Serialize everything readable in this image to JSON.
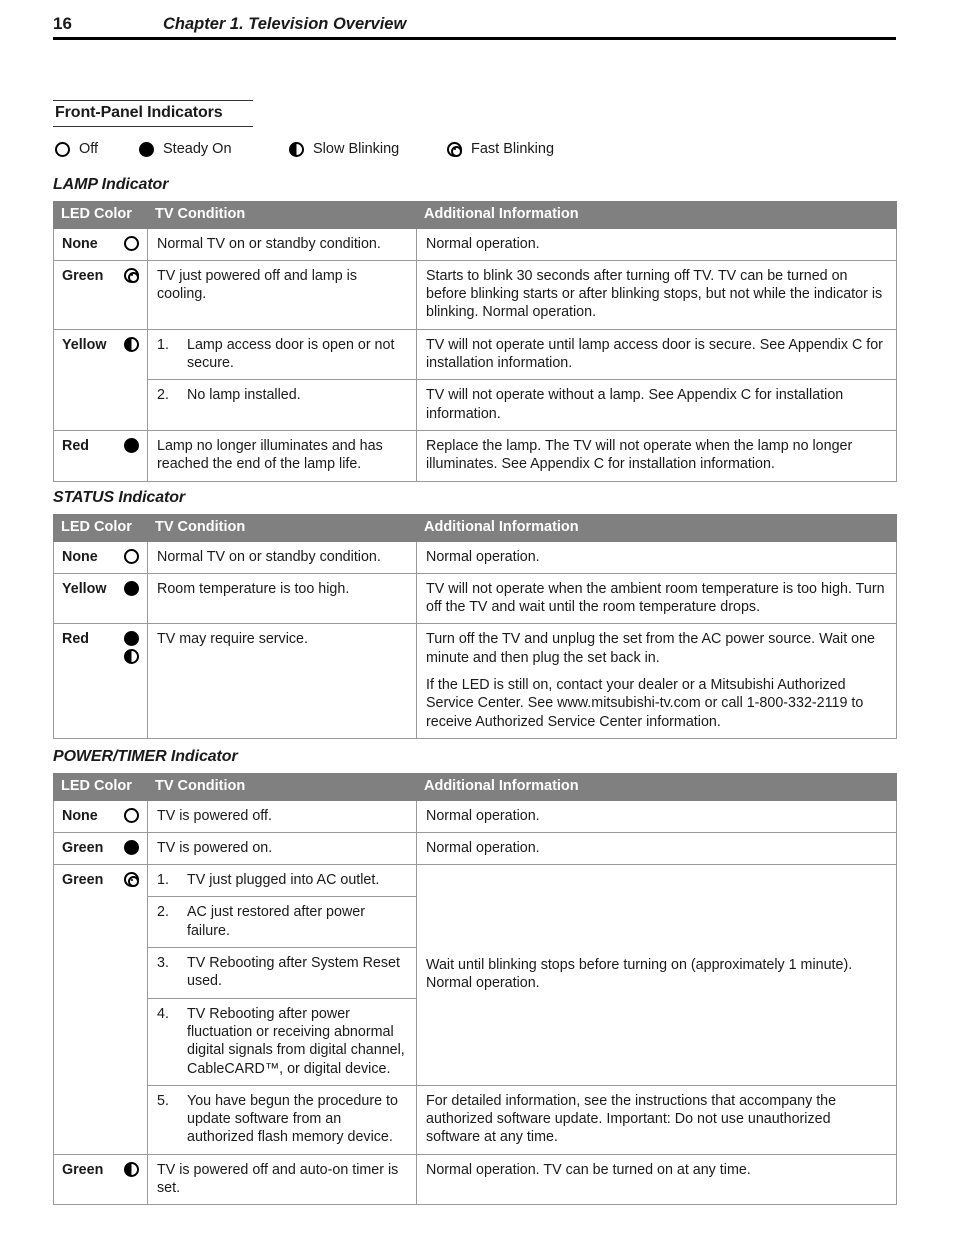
{
  "header": {
    "page_number": "16",
    "chapter_title": "Chapter 1. Television Overview"
  },
  "section": {
    "title": "Front-Panel Indicators"
  },
  "legend": {
    "items": [
      {
        "icon": "circle-outline-icon",
        "label": "Off"
      },
      {
        "icon": "circle-filled-icon",
        "label": "Steady On"
      },
      {
        "icon": "circle-half-filled-icon",
        "label": "Slow Blinking"
      },
      {
        "icon": "circle-bullseye-icon",
        "label": "Fast Blinking"
      }
    ]
  },
  "columns": {
    "led_color": "LED Color",
    "tv_condition": "TV Condition",
    "additional_information": "Additional Information"
  },
  "tables": [
    {
      "heading": "LAMP Indicator",
      "rows": [
        {
          "led_color": "None",
          "icons": [
            "circle-outline-icon"
          ],
          "condition": "Normal TV on or standby condition.",
          "information": [
            "Normal operation."
          ]
        },
        {
          "led_color": "Green",
          "icons": [
            "circle-bullseye-icon"
          ],
          "condition": "TV just powered off and lamp is cooling.",
          "information": [
            "Starts to blink 30 seconds after turning off TV.  TV can be turned on before blinking starts or after blinking stops, but not while the indicator is blinking.  Normal operation."
          ]
        },
        {
          "led_color": "Yellow",
          "icons": [
            "circle-half-filled-icon"
          ],
          "condition_list": [
            {
              "num": "1.",
              "text": "Lamp access door is open or not secure."
            },
            {
              "num": "2.",
              "text": "No lamp installed."
            }
          ],
          "information_list": [
            [
              "TV will not operate until lamp access door is secure.  See Appendix C for installation information."
            ],
            [
              "TV will not operate without a lamp.  See Appendix C for installation information."
            ]
          ]
        },
        {
          "led_color": "Red",
          "icons": [
            "circle-filled-icon"
          ],
          "condition": "Lamp no longer illuminates and has reached the end of the lamp life.",
          "information": [
            "Replace the lamp.  The TV will not operate when the lamp no longer illuminates.  See Appendix C for installation information."
          ]
        }
      ]
    },
    {
      "heading": "STATUS Indicator",
      "rows": [
        {
          "led_color": "None",
          "icons": [
            "circle-outline-icon"
          ],
          "condition": "Normal TV on or standby condition.",
          "information": [
            "Normal operation."
          ]
        },
        {
          "led_color": "Yellow",
          "icons": [
            "circle-filled-icon"
          ],
          "condition": "Room temperature is too high.",
          "information": [
            "TV will not operate when the ambient room temperature is too high.  Turn off the TV and wait until the room temperature drops."
          ]
        },
        {
          "led_color": "Red",
          "icons": [
            "circle-filled-icon",
            "circle-half-filled-icon"
          ],
          "condition": "TV may require service.",
          "information": [
            "Turn off the TV and unplug the set from the AC power source.  Wait one minute and then plug the set back in.",
            "If the LED is still on, contact your dealer or a Mitsubishi Authorized Service Center.  See www.mitsubishi-tv.com or call 1-800-332-2119 to receive Authorized Service Center information."
          ]
        }
      ]
    },
    {
      "heading": "POWER/TIMER Indicator",
      "rows": [
        {
          "led_color": "None",
          "icons": [
            "circle-outline-icon"
          ],
          "condition": "TV is powered off.",
          "information": [
            "Normal operation."
          ]
        },
        {
          "led_color": "Green",
          "icons": [
            "circle-filled-icon"
          ],
          "condition": "TV is powered on.",
          "information": [
            "Normal operation."
          ]
        },
        {
          "led_color": "Green",
          "icons": [
            "circle-bullseye-icon"
          ],
          "condition_list": [
            {
              "num": "1.",
              "text": "TV just plugged into AC outlet."
            },
            {
              "num": "2.",
              "text": "AC just restored after power failure."
            },
            {
              "num": "3.",
              "text": "TV Rebooting after System Reset used."
            },
            {
              "num": "4.",
              "text": "TV Rebooting after power fluctuation or receiving abnormal digital signals from digital channel, CableCARD™, or digital device."
            },
            {
              "num": "5.",
              "text": "You have begun the procedure to update software from an authorized flash memory device."
            }
          ],
          "information_merged": "Wait until blinking stops before turning on (approximately 1 minute).  Normal operation.",
          "information_last": "For detailed information, see the instructions that accompany the authorized software update.  Important:  Do not use unauthorized software at any time."
        },
        {
          "led_color": "Green",
          "icons": [
            "circle-half-filled-icon"
          ],
          "condition": "TV is powered off and auto-on timer is set.",
          "information": [
            "Normal operation.  TV can be turned on at any time."
          ]
        }
      ]
    }
  ]
}
